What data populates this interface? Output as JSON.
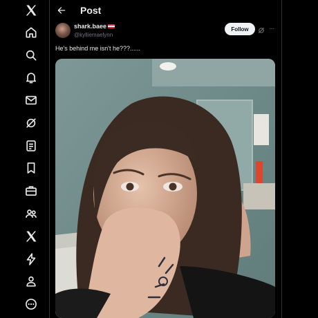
{
  "header": {
    "title": "Post"
  },
  "post": {
    "display_name": "shark.baee",
    "handle": "@kylliemaelynn",
    "follow_label": "Follow",
    "text": "He's behind me isn't he???......"
  },
  "sidebar": {
    "items": [
      "x-logo-icon",
      "home-icon",
      "explore-icon",
      "notifications-icon",
      "messages-icon",
      "grok-icon",
      "lists-icon",
      "bookmarks-icon",
      "jobs-icon",
      "communities-icon",
      "premium-icon",
      "verified-orgs-icon",
      "profile-icon",
      "more-icon"
    ]
  },
  "colors": {
    "background": "#000000",
    "text": "#e7e9ea",
    "muted": "#71767b",
    "follow_bg": "#eff3f4",
    "border": "#2f3336"
  }
}
